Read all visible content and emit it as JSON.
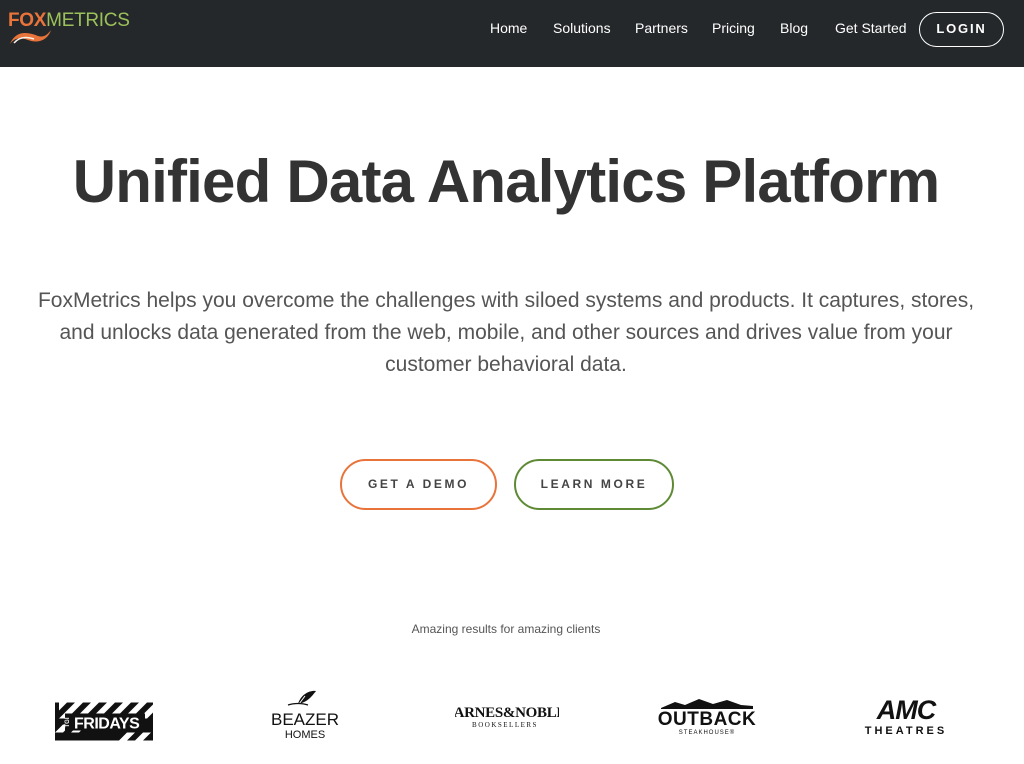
{
  "nav": {
    "logo": {
      "fox": "FOX",
      "metrics": "METRICS"
    },
    "links": [
      "Home",
      "Solutions",
      "Partners",
      "Pricing",
      "Blog",
      "Get Started"
    ],
    "login": "LOGIN"
  },
  "hero": {
    "title": "Unified Data Analytics Platform",
    "description": "FoxMetrics helps you overcome the challenges with siloed systems and products. It captures, stores, and unlocks data generated from the web, mobile, and other sources and drives value from your customer behavioral data.",
    "demo_button": "GET A DEMO",
    "learn_button": "LEARN MORE"
  },
  "clients": {
    "caption": "Amazing results for amazing clients",
    "logos": [
      {
        "name": "FRIDAYS",
        "small": "TGI"
      },
      {
        "name": "BEAZER",
        "sub": "HOMES"
      },
      {
        "name": "BARNES&NOBLE",
        "sub": "BOOKSELLERS"
      },
      {
        "name": "OUTBACK",
        "sub": "STEAKHOUSE®"
      },
      {
        "name": "AMC",
        "sub": "THEATRES"
      }
    ]
  },
  "colors": {
    "nav_bg": "#24282a",
    "fox_orange": "#e8743b",
    "metrics_green": "#9cc05a",
    "learn_green": "#5f8a35"
  }
}
